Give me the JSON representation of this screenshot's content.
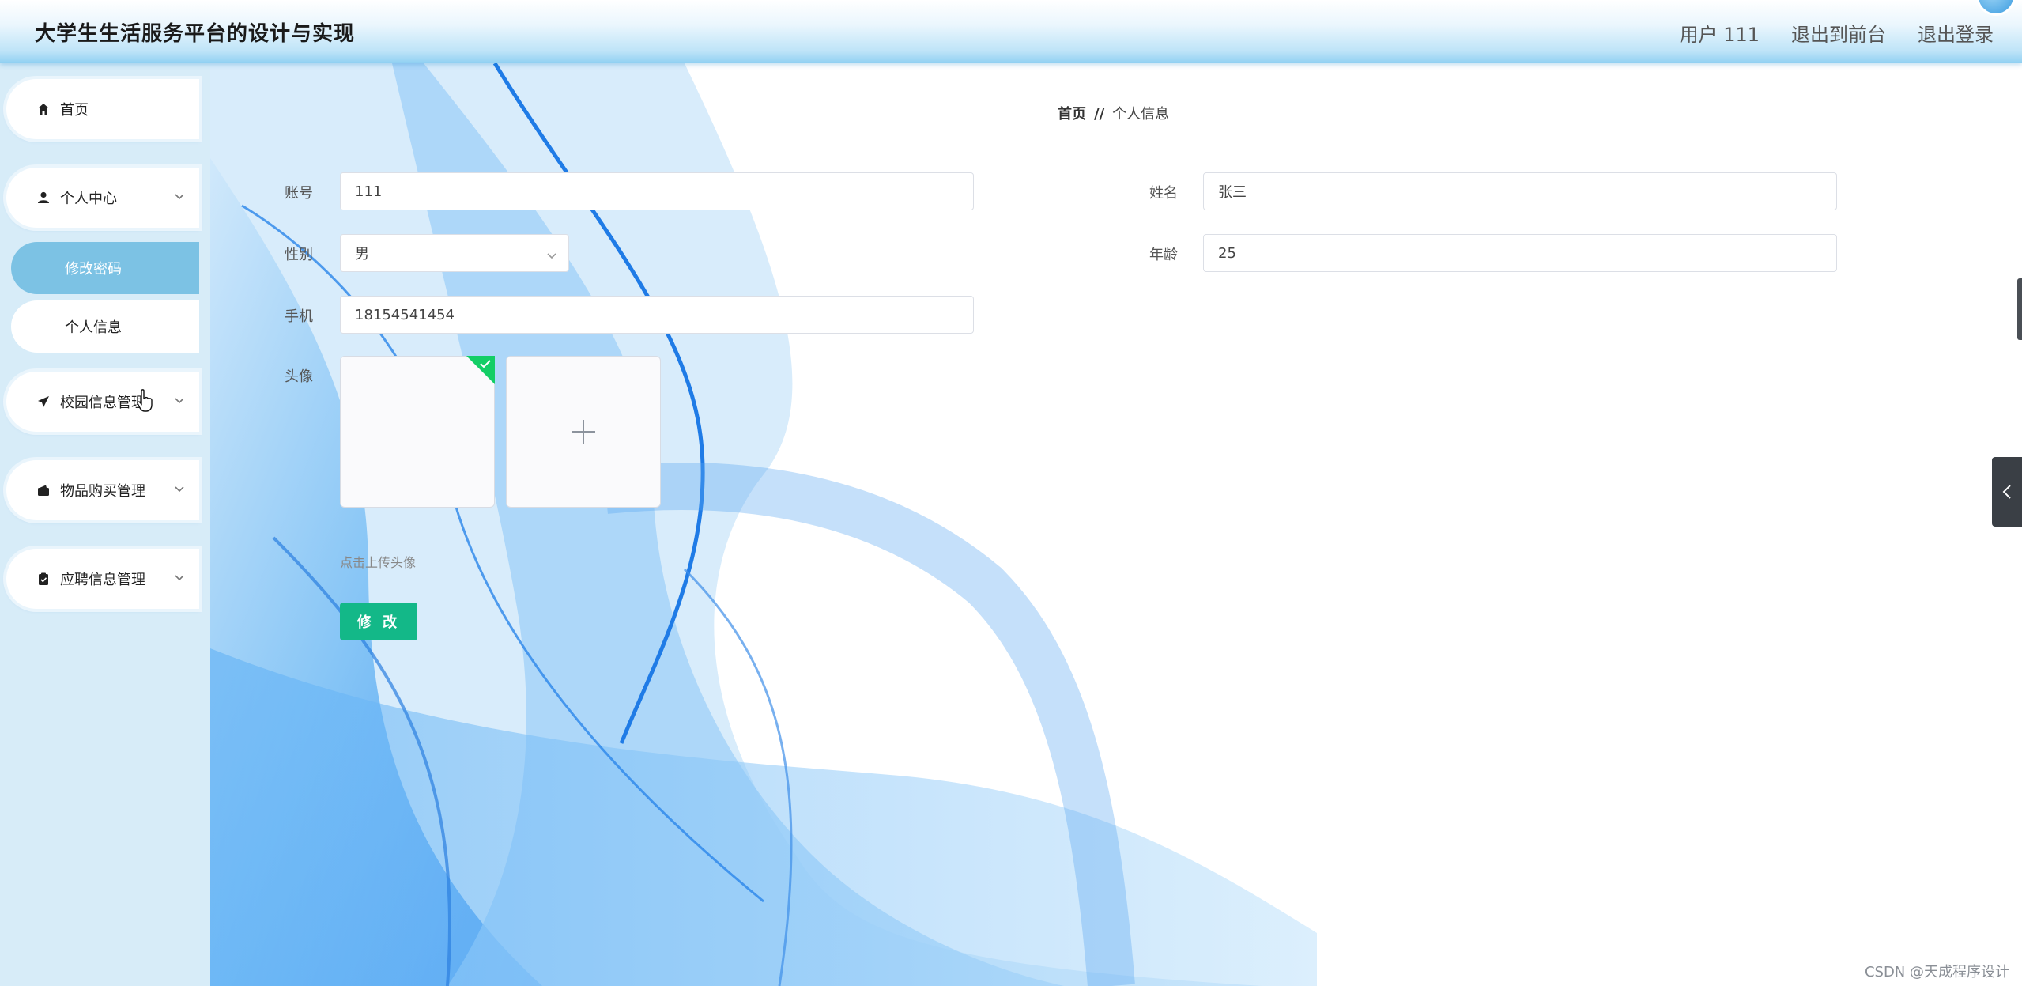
{
  "header": {
    "title": "大学生生活服务平台的设计与实现",
    "user_label": "用户 111",
    "to_front": "退出到前台",
    "logout": "退出登录"
  },
  "sidebar": {
    "items": [
      {
        "label": "首页",
        "icon": "home-icon"
      },
      {
        "label": "个人中心",
        "icon": "user-icon",
        "children": [
          {
            "label": "修改密码",
            "active": true
          },
          {
            "label": "个人信息",
            "active": false
          }
        ]
      },
      {
        "label": "校园信息管理",
        "icon": "send-icon"
      },
      {
        "label": "物品购买管理",
        "icon": "wallet-icon"
      },
      {
        "label": "应聘信息管理",
        "icon": "clipboard-icon"
      }
    ]
  },
  "breadcrumb": {
    "home": "首页",
    "sep": "//",
    "current": "个人信息"
  },
  "form": {
    "account": {
      "label": "账号",
      "value": "111"
    },
    "name": {
      "label": "姓名",
      "value": "张三"
    },
    "gender": {
      "label": "性别",
      "value": "男"
    },
    "age": {
      "label": "年龄",
      "value": "25"
    },
    "phone": {
      "label": "手机",
      "value": "18154541454"
    },
    "avatar": {
      "label": "头像",
      "hint": "点击上传头像"
    },
    "submit": "修 改"
  },
  "watermark": "CSDN @天成程序设计",
  "colors": {
    "accent": "#13b888",
    "sidebar_active": "#7cc2e4",
    "header_blue": "#8fd0f2"
  }
}
